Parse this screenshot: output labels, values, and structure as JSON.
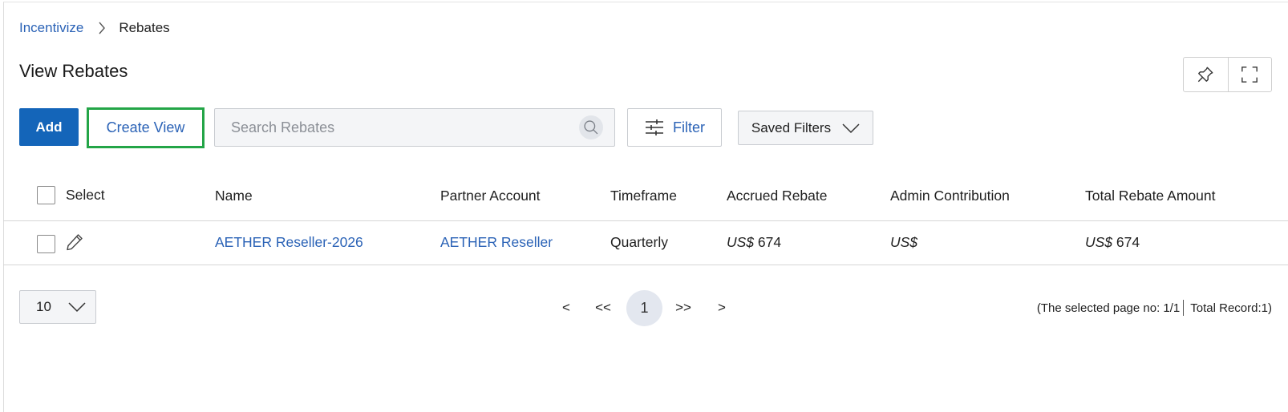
{
  "breadcrumb": {
    "parent": "Incentivize",
    "current": "Rebates"
  },
  "page_title": "View Rebates",
  "toolbar": {
    "add_label": "Add",
    "create_view_label": "Create View",
    "search_placeholder": "Search Rebates",
    "filter_label": "Filter",
    "saved_filters_label": "Saved Filters"
  },
  "table": {
    "columns": {
      "select": "Select",
      "name": "Name",
      "partner_account": "Partner Account",
      "timeframe": "Timeframe",
      "accrued_rebate": "Accrued Rebate",
      "admin_contribution": "Admin Contribution",
      "total_rebate_amount": "Total Rebate Amount"
    },
    "rows": [
      {
        "name": "AETHER Reseller-2026",
        "partner_account": "AETHER Reseller",
        "timeframe": "Quarterly",
        "accrued_currency": "US$",
        "accrued_value": "674",
        "admin_currency": "US$",
        "admin_value": "",
        "total_currency": "US$",
        "total_value": "674"
      }
    ]
  },
  "pagination": {
    "page_size": "10",
    "prev": "<",
    "first": "<<",
    "current_page": "1",
    "last": ">>",
    "next": ">",
    "selected_page_text": "(The selected page no: 1/1",
    "total_records_text": "Total Record:1)"
  },
  "colors": {
    "primary": "#1465b9",
    "link": "#2a62b6",
    "highlight_border": "#23a547"
  }
}
